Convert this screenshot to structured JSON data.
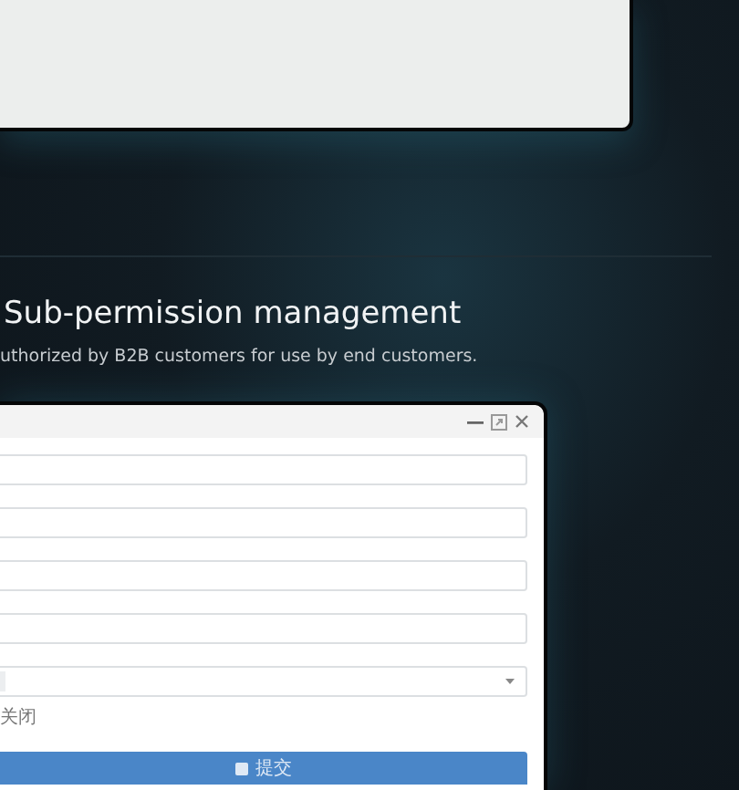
{
  "heading": "Sub-permission management",
  "description": "uthorized by B2B customers for use by end customers.",
  "dialog": {
    "fields": [
      {
        "kind": "text"
      },
      {
        "kind": "text"
      },
      {
        "kind": "text"
      },
      {
        "kind": "text"
      },
      {
        "kind": "select"
      }
    ],
    "switch_label": "关闭",
    "submit": "提交"
  }
}
